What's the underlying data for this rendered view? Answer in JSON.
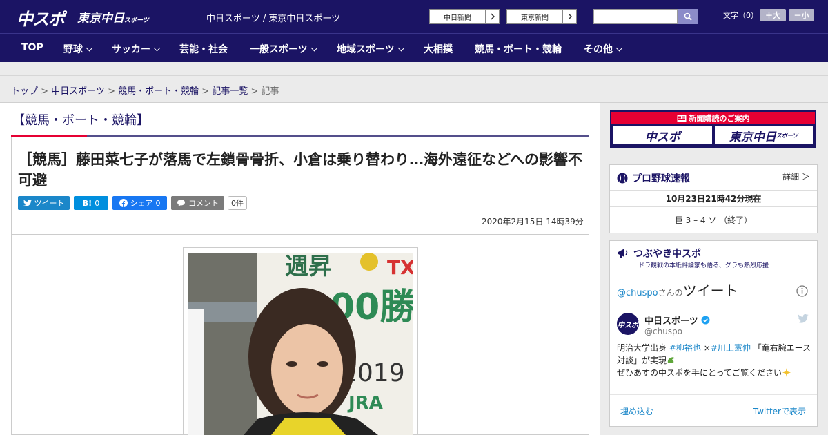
{
  "header": {
    "logo_chuspo": "中スポ",
    "logo_tokyo": "東京中日",
    "logo_tokyo_sub": "スポーツ",
    "site_names": "中日スポーツ / 東京中日スポーツ",
    "paper_links": [
      "中日新聞",
      "東京新聞"
    ],
    "search": {
      "placeholder": ""
    },
    "font_size_label": "文字（0）",
    "font_larger": "＋大",
    "font_smaller": "－小"
  },
  "nav": {
    "items": [
      {
        "label": "TOP"
      },
      {
        "label": "野球"
      },
      {
        "label": "サッカー"
      },
      {
        "label": "芸能・社会"
      },
      {
        "label": "一般スポーツ"
      },
      {
        "label": "地域スポーツ"
      },
      {
        "label": "大相撲"
      },
      {
        "label": "競馬・ボート・競輪"
      },
      {
        "label": "その他"
      }
    ]
  },
  "breadcrumb": {
    "items": [
      "トップ",
      "中日スポーツ",
      "競馬・ボート・競輪",
      "記事一覧"
    ],
    "current": "記事",
    "sep": ">"
  },
  "article": {
    "category": "【競馬・ボート・競輪】",
    "title": "［競馬］藤田菜七子が落馬で左鎖骨骨折、小倉は乗り替わり…海外遠征などへの影響不可避",
    "share": {
      "tweet": "ツイート",
      "hatena": "B!",
      "hatena_count": "0",
      "facebook": "シェア",
      "facebook_count": "0",
      "comment": "コメント",
      "comment_count": "0件"
    },
    "date": "2020年2月15日 14時39分",
    "photo_text": {
      "top": "週昇",
      "tx": "TX",
      "big": "00勝",
      "year": "2019",
      "jra": "JRA"
    }
  },
  "sidebar": {
    "subscribe": {
      "title": "新聞購読のご案内",
      "logo1": "中スポ",
      "logo2": "東京中日",
      "logo2_sub": "スポーツ"
    },
    "baseball": {
      "title": "プロ野球速報",
      "detail": "詳細 ＞",
      "time": "10月23日21時42分現在",
      "score": "巨 3 – 4 ソ （終了）"
    },
    "tweets": {
      "title": "つぶやき中スポ",
      "subtitle": "ドラ観戦の本紙評論家も語る、グラも熱烈応援",
      "handle": "@chuspo",
      "handle_suffix": "さんの",
      "tweets_label": "ツイート",
      "account_name": "中日スポーツ",
      "account_handle": "@chuspo",
      "avatar_text": "中スポ",
      "tweet_line1_a": "明治大学出身 ",
      "tweet_tag1": "#柳裕也",
      "tweet_line1_b": " ×",
      "tweet_tag2": "#川上憲伸",
      "tweet_line1_c": " 「竜右腕エース",
      "tweet_line2": "対談」が実現",
      "tweet_line3": "ぜひあすの中スポを手にとってご覧ください",
      "embed": "埋め込む",
      "view_on_twitter": "Twitterで表示"
    }
  },
  "colors": {
    "brand_navy": "#1b1464",
    "accent_red": "#e60033",
    "twitter_blue": "#1b87c9",
    "hatena_blue": "#008fde",
    "facebook_blue": "#1877f2"
  }
}
